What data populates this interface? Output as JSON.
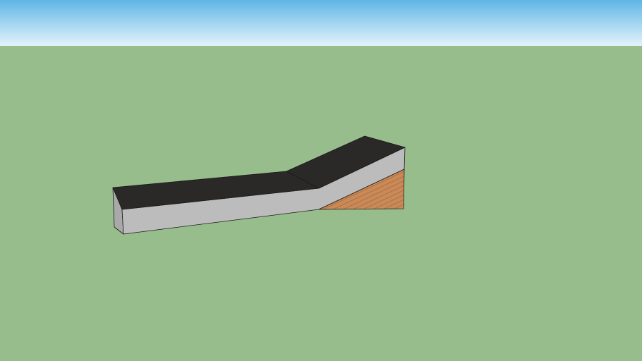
{
  "scene": {
    "colors": {
      "sky_top": "#5fb6e6",
      "sky_horizon": "#e6f3fb",
      "ground": "#98bd8c",
      "top_surface": "#2b2828",
      "side_concrete": "#bcbcbc",
      "side_concrete_dark": "#a9a9a9",
      "wood": "#c98a58",
      "edge": "#1a1a1a"
    }
  }
}
